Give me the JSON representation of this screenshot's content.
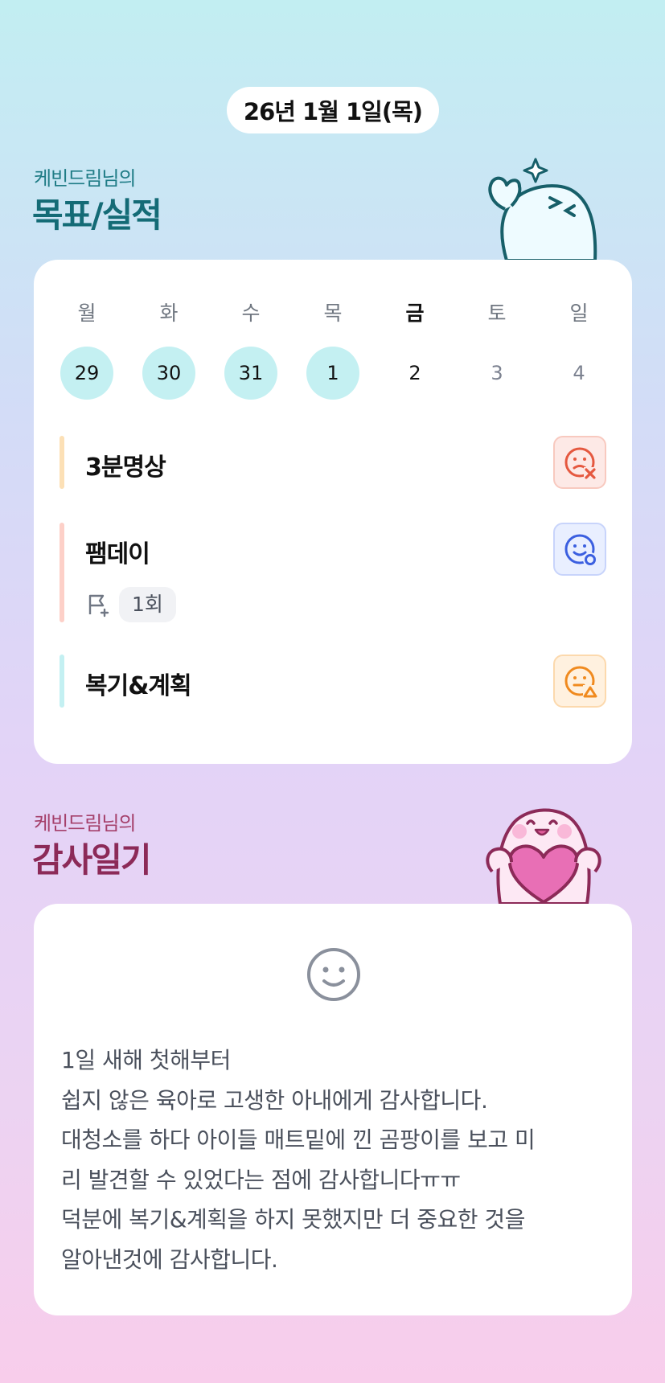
{
  "date_label": "26년 1월 1일(목)",
  "goals_section": {
    "subtitle": "케빈드림님의",
    "title": "목표/실적"
  },
  "week": {
    "days": [
      "월",
      "화",
      "수",
      "목",
      "금",
      "토",
      "일"
    ],
    "dates": [
      "29",
      "30",
      "31",
      "1",
      "2",
      "3",
      "4"
    ],
    "completed_dates": [
      "29",
      "30",
      "31",
      "1"
    ],
    "highlighted_day": "금"
  },
  "goals": [
    {
      "name": "3분명상",
      "status_icon": "sad-face-x-icon",
      "accent": "#fce0b6"
    },
    {
      "name": "팸데이",
      "status_icon": "smile-face-check-icon",
      "accent": "#fdd0c8",
      "count": "1회"
    },
    {
      "name": "복기&계획",
      "status_icon": "neutral-face-triangle-icon",
      "accent": "#c4f0f2"
    }
  ],
  "journal_section": {
    "subtitle": "케빈드림님의",
    "title": "감사일기"
  },
  "journal": {
    "mood_icon": "smile-face-icon",
    "lines": [
      "1일 새해 첫해부터",
      "쉽지 않은 육아로 고생한 아내에게 감사합니다.",
      "대청소를 하다 아이들 매트밑에 낀 곰팡이를 보고 미",
      "리 발견할 수 있었다는 점에 감사합니다ㅠㅠ",
      "덕분에 복기&계획을 하지 못했지만 더 중요한 것을",
      "알아낸것에 감사합니다."
    ]
  },
  "colors": {
    "teal": "#1f7c86",
    "plum": "#a5406b",
    "fail_red": "#e5583f",
    "success_blue": "#3b5fe0",
    "partial_orange": "#f08a1e",
    "done_circle": "#c4f0f2"
  }
}
